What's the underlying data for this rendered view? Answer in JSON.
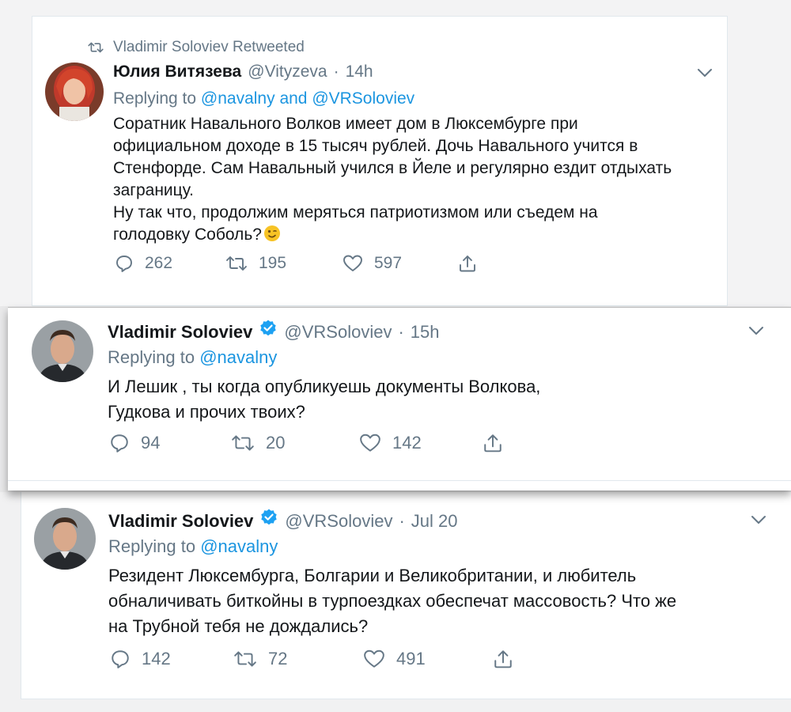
{
  "tweets": [
    {
      "retweeted_by": "Vladimir Soloviev Retweeted",
      "name": "Юлия Витязева",
      "handle": "@Vityzeva",
      "sep": "·",
      "time": "14h",
      "reply_prefix": "Replying to ",
      "reply_mentions": "@navalny and @VRSoloviev",
      "text": "Соратник Навального Волков имеет дом в Люксембурге при\nофициальном доходе в 15 тысяч рублей. Дочь Навального учится в\nСтенфорде. Сам Навальный учился в Йеле и регулярно ездит отдыхать\nзаграницу.\nНу так что, продолжим меряться патриотизмом или съедем на\nголодовку Соболь?",
      "emoji": "wink-emoji",
      "replies": "262",
      "retweets": "195",
      "likes": "597"
    },
    {
      "name": "Vladimir Soloviev",
      "handle": "@VRSoloviev",
      "sep": "·",
      "time": "15h",
      "reply_prefix": "Replying to ",
      "reply_mentions": "@navalny",
      "text": "И Лешик , ты когда опубликуешь документы Волкова,\nГудкова и прочих твоих?",
      "replies": "94",
      "retweets": "20",
      "likes": "142"
    },
    {
      "name": "Vladimir Soloviev",
      "handle": "@VRSoloviev",
      "sep": "·",
      "time": "Jul 20",
      "reply_prefix": "Replying to ",
      "reply_mentions": "@navalny",
      "text": "Резидент Люксембурга, Болгарии и Великобритании, и любитель\nобналичивать биткойны в турпоездках обеспечат массовость? Что же\nна Трубной тебя не дождались?",
      "replies": "142",
      "retweets": "72",
      "likes": "491"
    }
  ],
  "icons": {
    "reply": "reply-icon",
    "retweet": "retweet-icon",
    "like": "heart-icon",
    "share": "share-icon",
    "more": "chevron-down-icon",
    "verified": "verified-badge-icon"
  },
  "colors": {
    "link": "#1b95e0",
    "muted": "#657786",
    "text": "#14171a",
    "verified": "#1da1f2"
  }
}
